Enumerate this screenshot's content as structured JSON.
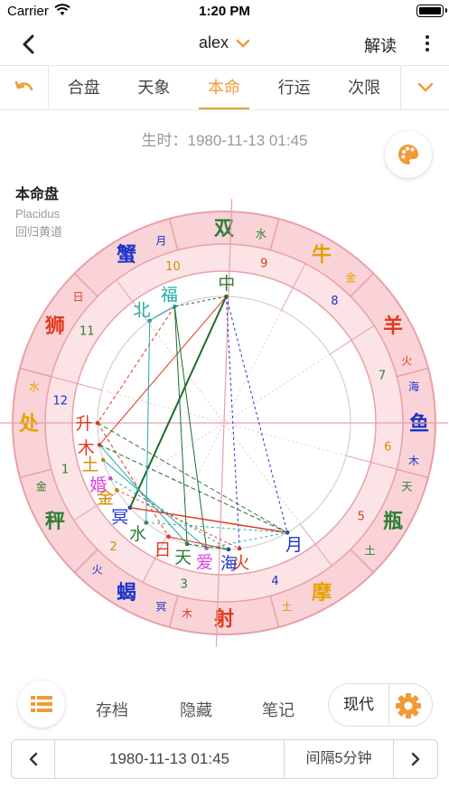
{
  "status": {
    "carrier": "Carrier",
    "time": "1:20 PM"
  },
  "nav": {
    "title": "alex",
    "interpret": "解读"
  },
  "tabs": [
    {
      "label": "合盘",
      "active": false
    },
    {
      "label": "天象",
      "active": false
    },
    {
      "label": "本命",
      "active": true
    },
    {
      "label": "行运",
      "active": false
    },
    {
      "label": "次限",
      "active": false
    }
  ],
  "birthtime": "生时：1980-11-13 01:45",
  "chart_info": {
    "title": "本命盘",
    "house_system": "Placidus",
    "zodiac": "回归黄道"
  },
  "chart": {
    "signs": [
      {
        "name": "双",
        "ruler": "水",
        "color": "#2e7d32"
      },
      {
        "name": "牛",
        "ruler": "金",
        "color": "#e6a100"
      },
      {
        "name": "羊",
        "ruler": "火",
        "color": "#e03a1e"
      },
      {
        "name": "鱼",
        "ruler": "木",
        "ruler2": "海",
        "color": "#1a33c8"
      },
      {
        "name": "瓶",
        "ruler": "土",
        "ruler2": "天",
        "color": "#2e7d32"
      },
      {
        "name": "摩",
        "ruler": "土",
        "color": "#e6a100"
      },
      {
        "name": "射",
        "ruler": "木",
        "color": "#e03a1e"
      },
      {
        "name": "蝎",
        "ruler": "火",
        "ruler2": "冥",
        "color": "#1a33c8"
      },
      {
        "name": "秤",
        "ruler": "金",
        "color": "#2e7d32"
      },
      {
        "name": "处",
        "ruler": "水",
        "color": "#e6a100"
      },
      {
        "name": "狮",
        "ruler": "日",
        "color": "#e03a1e"
      },
      {
        "name": "蟹",
        "ruler": "月",
        "color": "#1a33c8"
      }
    ],
    "houses": [
      "1",
      "2",
      "3",
      "4",
      "5",
      "6",
      "7",
      "8",
      "9",
      "10",
      "11",
      "12"
    ],
    "planets": [
      {
        "label": "中",
        "color": "#2e7d32"
      },
      {
        "label": "福",
        "color": "#22aaaa"
      },
      {
        "label": "北",
        "color": "#22aaaa"
      },
      {
        "label": "升",
        "color": "#e03a1e"
      },
      {
        "label": "木",
        "color": "#e03a1e"
      },
      {
        "label": "土",
        "color": "#d09000"
      },
      {
        "label": "婚",
        "color": "#e040e0"
      },
      {
        "label": "金",
        "color": "#d09000"
      },
      {
        "label": "冥",
        "color": "#1a33c8"
      },
      {
        "label": "水",
        "color": "#2e7d32"
      },
      {
        "label": "日",
        "color": "#e03a1e"
      },
      {
        "label": "天",
        "color": "#2e7d32"
      },
      {
        "label": "爱",
        "color": "#e040e0"
      },
      {
        "label": "海",
        "color": "#1a33c8"
      },
      {
        "label": "火",
        "color": "#e03a1e"
      },
      {
        "label": "月",
        "color": "#1a33c8"
      }
    ],
    "aspect_colors": {
      "red": "#e03a1e",
      "green": "#1e6b2e",
      "cyan": "#22aaaa",
      "blue": "#2a2ae0"
    }
  },
  "toolbar": {
    "archive": "存档",
    "hide": "隐藏",
    "notes": "笔记",
    "mode": "现代"
  },
  "stepper": {
    "date": "1980-11-13 01:45",
    "interval": "间隔5分钟"
  },
  "colors": {
    "accent": "#f29a38",
    "ring_fill": "#f9d3d7",
    "ring_stroke": "#e9a0a8"
  }
}
